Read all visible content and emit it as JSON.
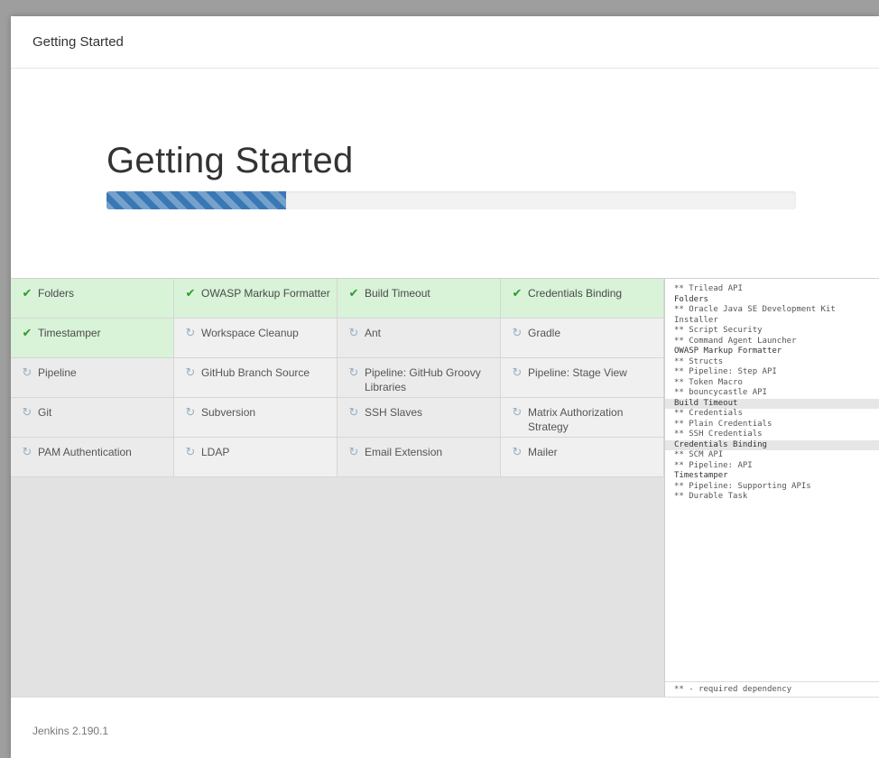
{
  "dialog": {
    "title": "Getting Started"
  },
  "hero": {
    "title": "Getting Started",
    "progress_percent": 26
  },
  "plugins": [
    {
      "label": "Folders",
      "status": "done"
    },
    {
      "label": "OWASP Markup Formatter",
      "status": "done"
    },
    {
      "label": "Build Timeout",
      "status": "done"
    },
    {
      "label": "Credentials Binding",
      "status": "done"
    },
    {
      "label": "Timestamper",
      "status": "done"
    },
    {
      "label": "Workspace Cleanup",
      "status": "pending"
    },
    {
      "label": "Ant",
      "status": "pending"
    },
    {
      "label": "Gradle",
      "status": "pending"
    },
    {
      "label": "Pipeline",
      "status": "pending"
    },
    {
      "label": "GitHub Branch Source",
      "status": "pending"
    },
    {
      "label": "Pipeline: GitHub Groovy Libraries",
      "status": "pending"
    },
    {
      "label": "Pipeline: Stage View",
      "status": "pending"
    },
    {
      "label": "Git",
      "status": "pending"
    },
    {
      "label": "Subversion",
      "status": "pending"
    },
    {
      "label": "SSH Slaves",
      "status": "pending"
    },
    {
      "label": "Matrix Authorization Strategy",
      "status": "pending"
    },
    {
      "label": "PAM Authentication",
      "status": "pending"
    },
    {
      "label": "LDAP",
      "status": "pending"
    },
    {
      "label": "Email Extension",
      "status": "pending"
    },
    {
      "label": "Mailer",
      "status": "pending"
    }
  ],
  "log": {
    "lines": [
      {
        "text": "** Trilead API",
        "type": "dep"
      },
      {
        "text": "Folders",
        "type": "head"
      },
      {
        "text": "** Oracle Java SE Development Kit",
        "type": "dep"
      },
      {
        "text": "Installer",
        "type": "dep"
      },
      {
        "text": "** Script Security",
        "type": "dep"
      },
      {
        "text": "** Command Agent Launcher",
        "type": "dep"
      },
      {
        "text": "OWASP Markup Formatter",
        "type": "head"
      },
      {
        "text": "** Structs",
        "type": "dep"
      },
      {
        "text": "** Pipeline: Step API",
        "type": "dep"
      },
      {
        "text": "** Token Macro",
        "type": "dep"
      },
      {
        "text": "** bouncycastle API",
        "type": "dep"
      },
      {
        "text": "Build Timeout",
        "type": "hl"
      },
      {
        "text": "** Credentials",
        "type": "dep"
      },
      {
        "text": "** Plain Credentials",
        "type": "dep"
      },
      {
        "text": "** SSH Credentials",
        "type": "dep"
      },
      {
        "text": "Credentials Binding",
        "type": "hl"
      },
      {
        "text": "** SCM API",
        "type": "dep"
      },
      {
        "text": "** Pipeline: API",
        "type": "dep"
      },
      {
        "text": "Timestamper",
        "type": "head"
      },
      {
        "text": "** Pipeline: Supporting APIs",
        "type": "dep"
      },
      {
        "text": "** Durable Task",
        "type": "dep"
      }
    ],
    "footer": "** - required dependency"
  },
  "footer": {
    "version": "Jenkins 2.190.1"
  },
  "icons": {
    "done": "check-icon",
    "pending": "refresh-icon"
  },
  "colors": {
    "accent": "#3a78b5",
    "done_bg": "#d8f3d8",
    "check": "#2e9b2e"
  }
}
